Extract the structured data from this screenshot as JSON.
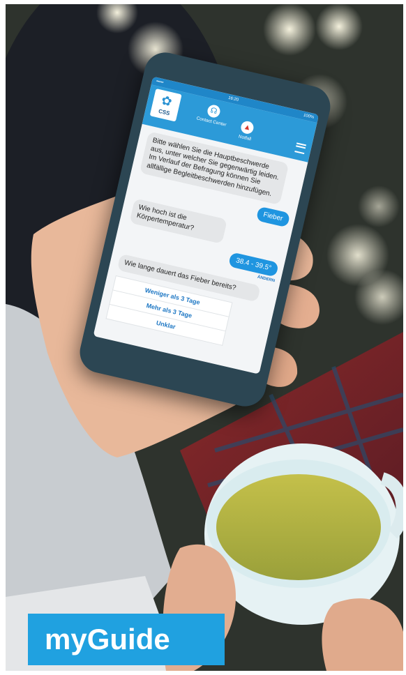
{
  "app": {
    "logo_text": "CSS",
    "logo_icon": "lotus-icon",
    "contact_center_label": "Contact Center",
    "contact_center_icon": "headset-icon",
    "notfall_label": "Notfall",
    "notfall_icon": "siren-icon",
    "menu_icon": "hamburger-icon",
    "status_time": "16:20",
    "status_battery": "100%"
  },
  "chat": {
    "bot_msg_1": "Bitte wählen Sie die Hauptbeschwerde aus, unter welcher Sie gegenwärtig leiden. Im Verlauf der Befragung können Sie allfällige Begleitbeschwerden hinzufügen.",
    "bot_msg_2": "Wie hoch ist die Körpertemperatur?",
    "user_msg_1": "Fieber",
    "user_msg_2": "38.4 - 39.5°",
    "edit_label": "ÄNDERN",
    "bot_msg_3": "Wie lange dauert das Fieber bereits?",
    "options": [
      "Weniger als 3 Tage",
      "Mehr als 3 Tage",
      "Unklar"
    ]
  },
  "brand": {
    "title": "myGuide",
    "accent_color": "#20a1e0"
  }
}
